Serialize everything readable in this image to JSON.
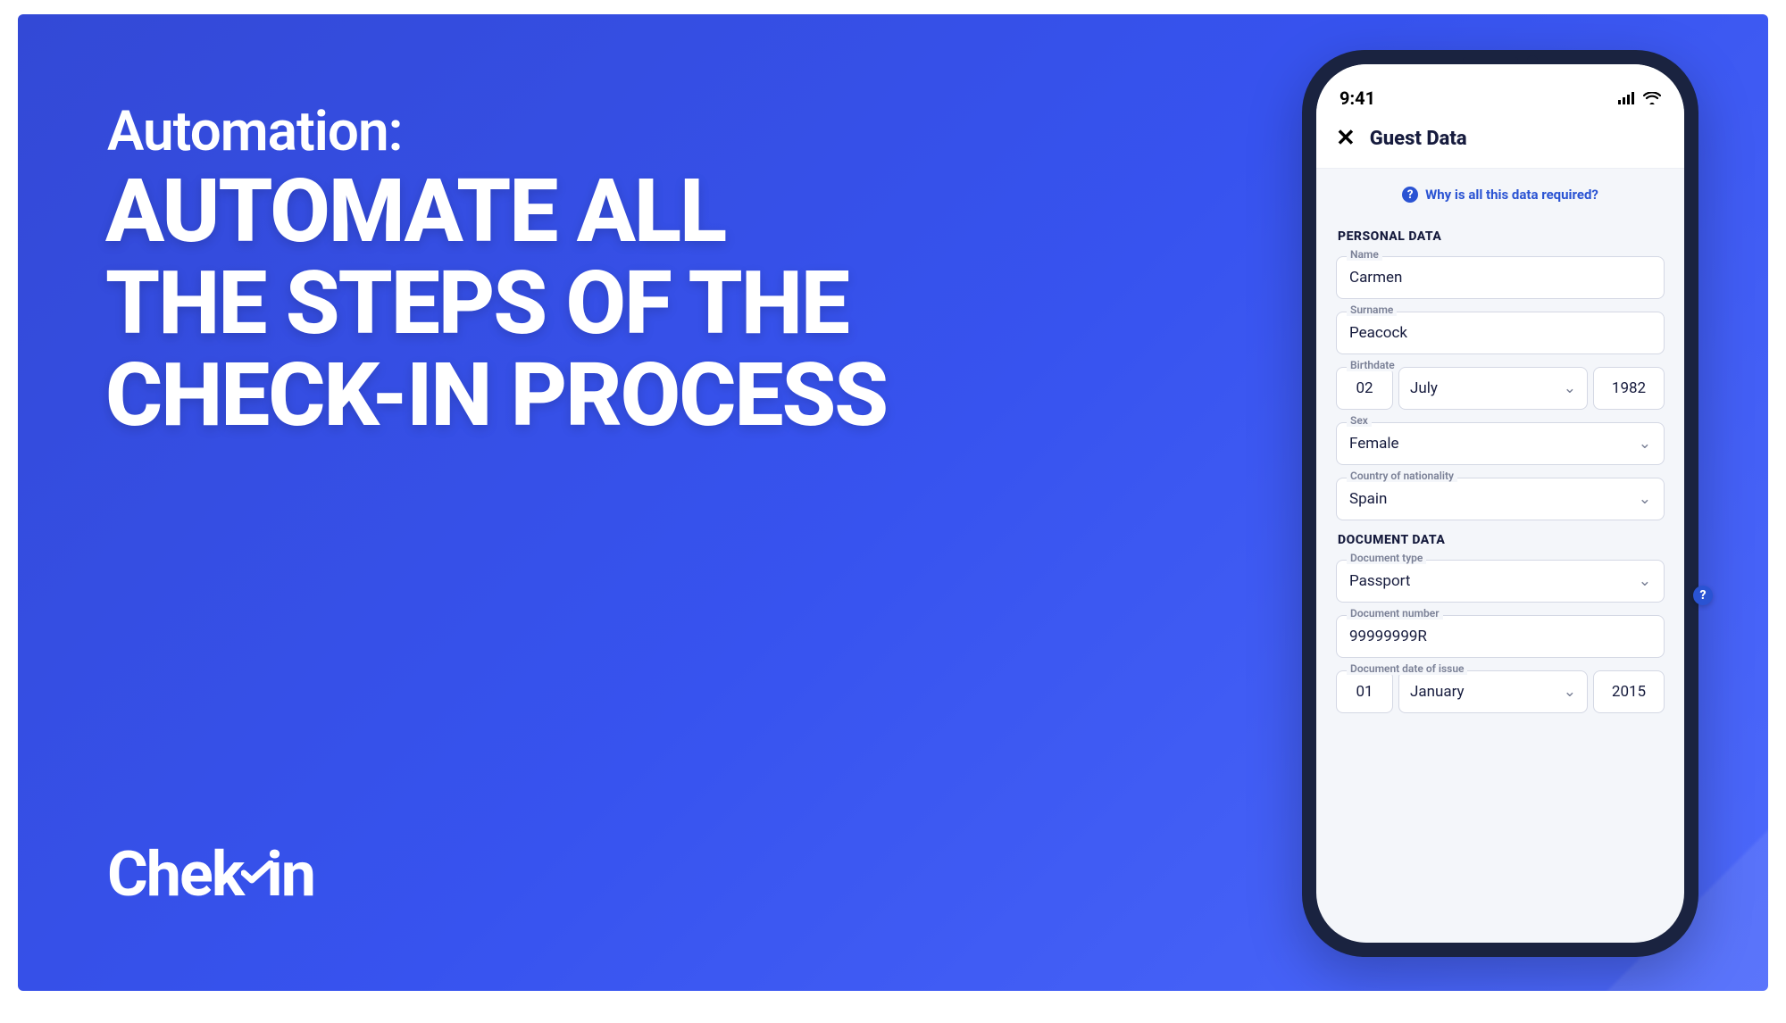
{
  "headline": {
    "sub": "Automation:",
    "main": "AUTOMATE ALL\nTHE STEPS OF THE\nCHECK-IN PROCESS"
  },
  "brand": "Chekin",
  "phone": {
    "status_time": "9:41",
    "header_title": "Guest Data",
    "info_link": "Why is all this data required?",
    "sections": {
      "personal": {
        "title": "PERSONAL DATA",
        "fields": {
          "name": {
            "label": "Name",
            "value": "Carmen"
          },
          "surname": {
            "label": "Surname",
            "value": "Peacock"
          },
          "birthdate": {
            "label": "Birthdate",
            "day": "02",
            "month": "July",
            "year": "1982"
          },
          "sex": {
            "label": "Sex",
            "value": "Female"
          },
          "nationality": {
            "label": "Country of nationality",
            "value": "Spain"
          }
        }
      },
      "document": {
        "title": "DOCUMENT DATA",
        "fields": {
          "type": {
            "label": "Document type",
            "value": "Passport"
          },
          "number": {
            "label": "Document number",
            "value": "99999999R"
          },
          "issue": {
            "label": "Document date of issue",
            "day": "01",
            "month": "January",
            "year": "2015"
          }
        }
      }
    }
  }
}
